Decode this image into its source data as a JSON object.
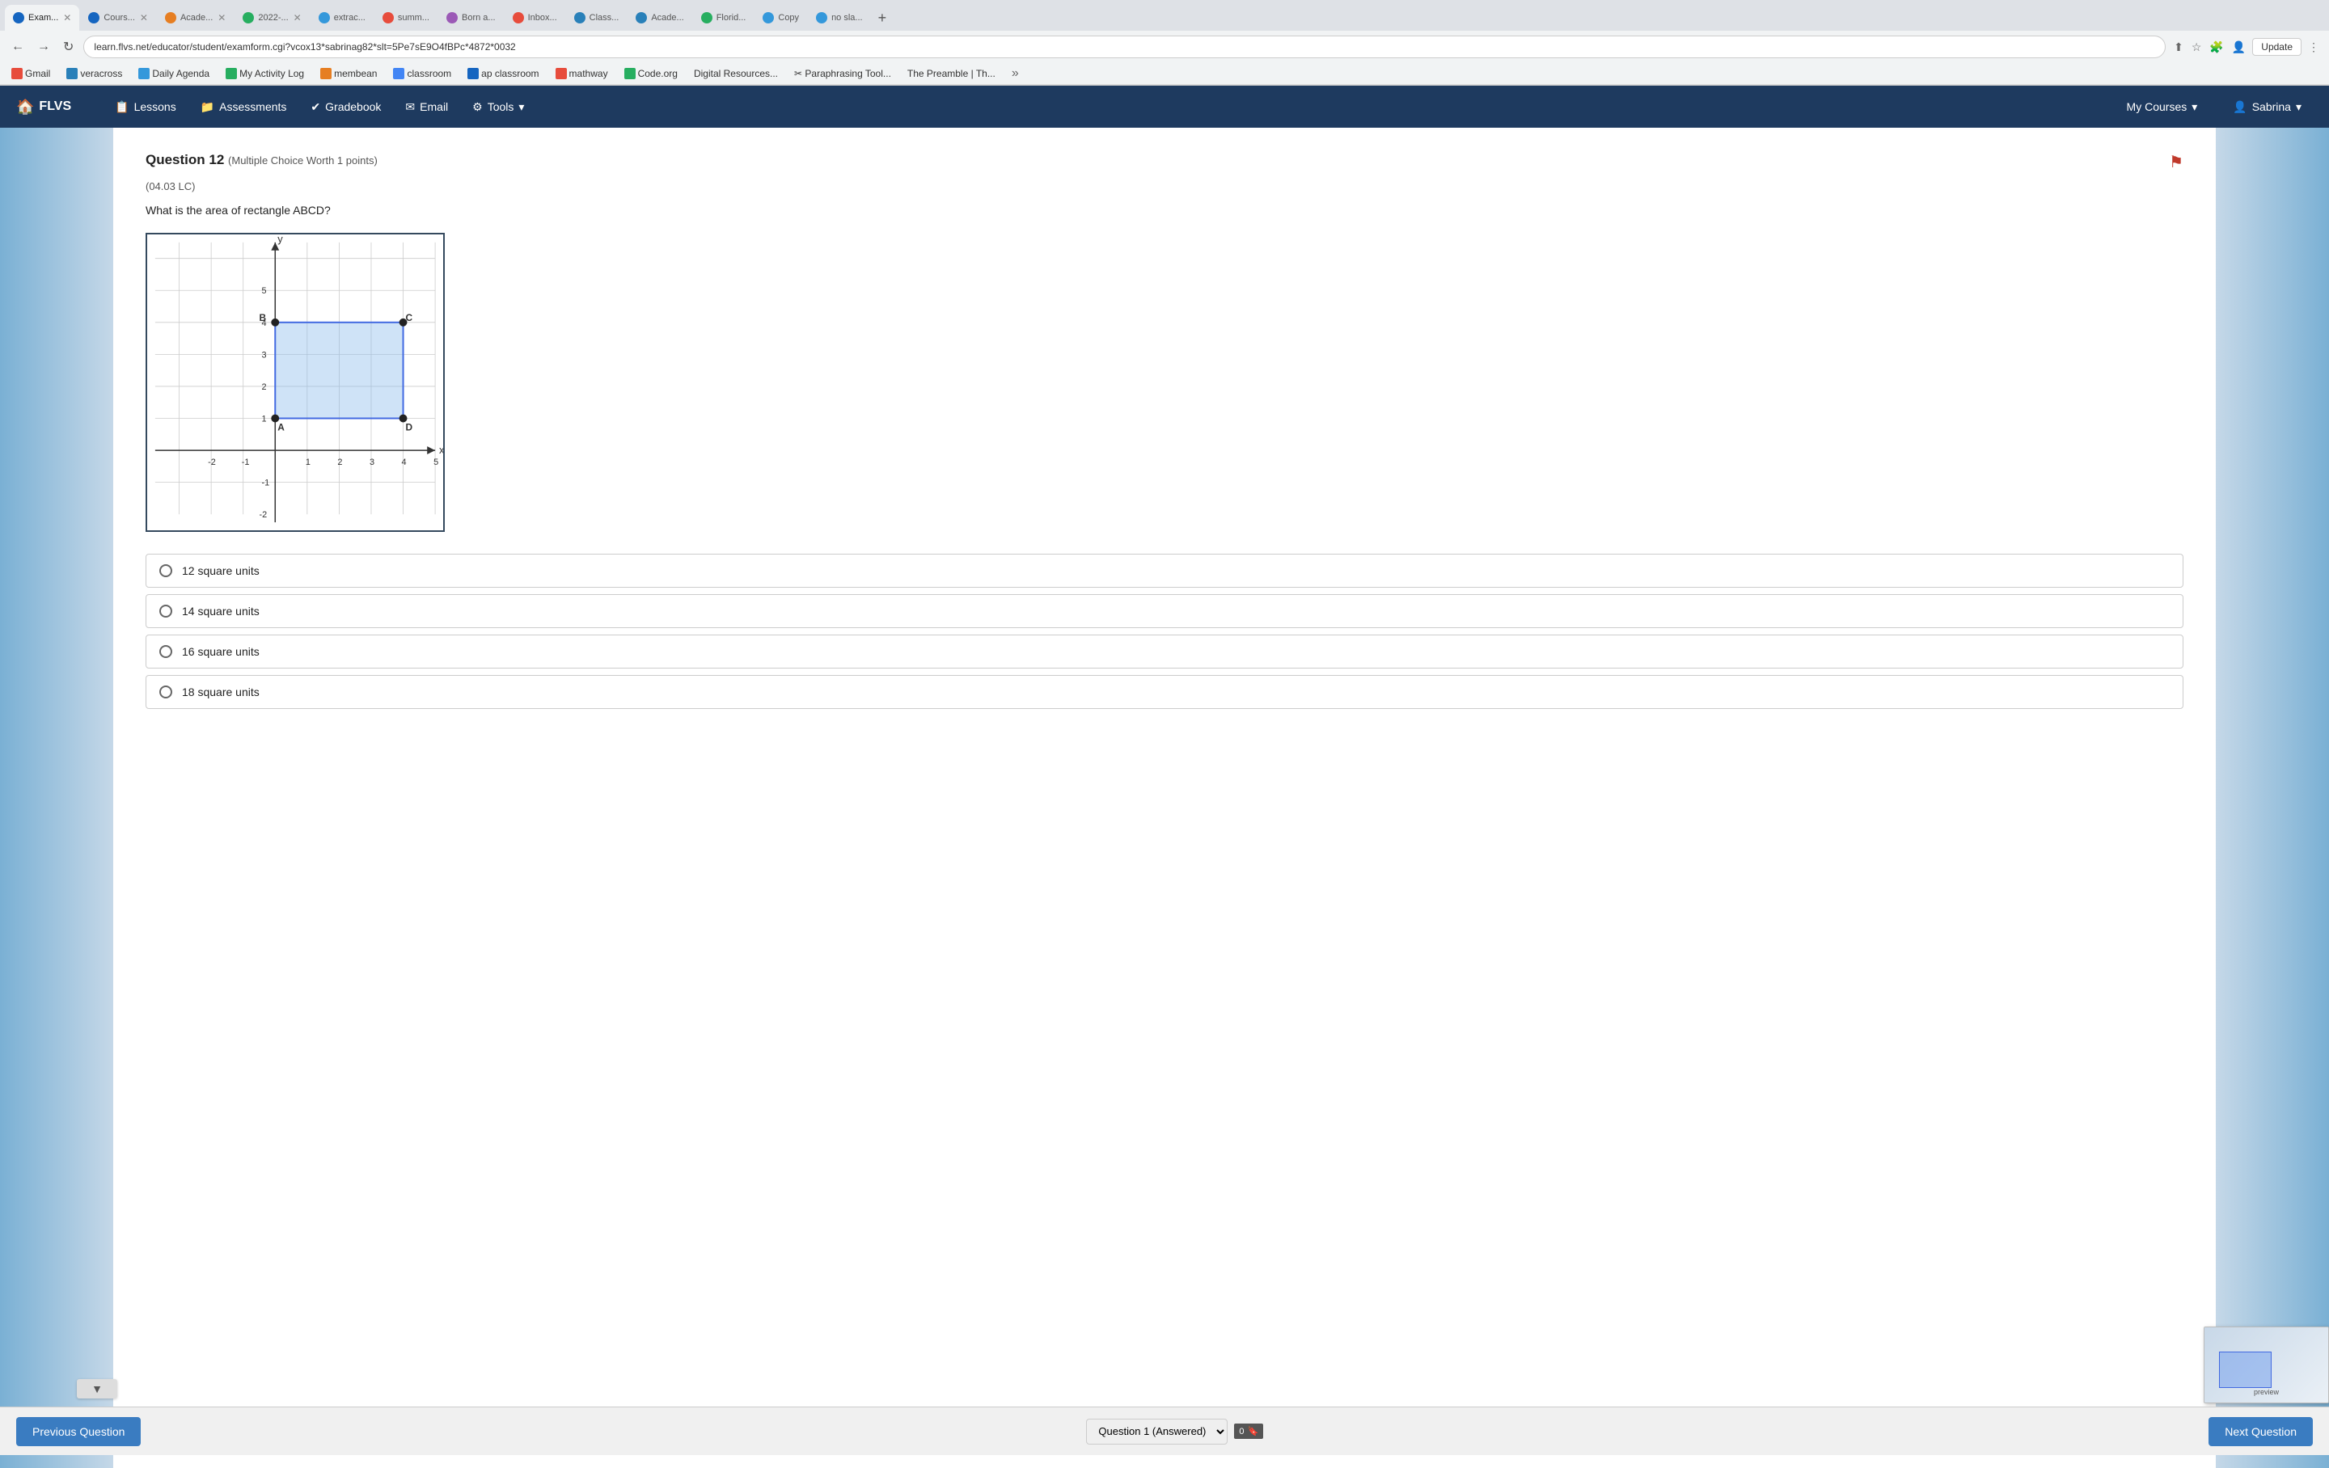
{
  "browser": {
    "address": "learn.flvs.net/educator/student/examform.cgi?vcox13*sabrinag82*slt=5Pe7sE9O4fBPc*4872*0032",
    "update_label": "Update",
    "tabs": [
      {
        "label": "Acade...",
        "active": false,
        "color": "#e67e22"
      },
      {
        "label": "2022-...",
        "active": false,
        "color": "#27ae60"
      },
      {
        "label": "extrac...",
        "active": false,
        "color": "#3498db"
      },
      {
        "label": "summ...",
        "active": false,
        "color": "#e74c3c"
      },
      {
        "label": "Born a...",
        "active": false,
        "color": "#9b59b6"
      },
      {
        "label": "Inbox ...",
        "active": false,
        "color": "#e74c3c"
      },
      {
        "label": "Class...",
        "active": false,
        "color": "#2980b9"
      },
      {
        "label": "Acade...",
        "active": false,
        "color": "#2980b9"
      },
      {
        "label": "Florid...",
        "active": false,
        "color": "#27ae60"
      },
      {
        "label": "Copy",
        "active": false,
        "color": "#3498db"
      },
      {
        "label": "no sla...",
        "active": false,
        "color": "#3498db"
      },
      {
        "label": "Exam...",
        "active": true,
        "color": "#1565C0"
      },
      {
        "label": "Cours...",
        "active": false,
        "color": "#1565C0"
      },
      {
        "label": "+",
        "active": false
      }
    ],
    "bookmarks": [
      {
        "label": "Gmail",
        "color": "#e74c3c"
      },
      {
        "label": "veracross",
        "color": "#2980b9"
      },
      {
        "label": "Daily Agenda",
        "color": "#3498db"
      },
      {
        "label": "My Activity Log",
        "color": "#27ae60"
      },
      {
        "label": "membean",
        "color": "#e67e22"
      },
      {
        "label": "classroom",
        "color": "#4285f4"
      },
      {
        "label": "ap classroom",
        "color": "#1565C0"
      },
      {
        "label": "mathway",
        "color": "#e74c3c"
      },
      {
        "label": "Code.org",
        "color": "#27ae60"
      },
      {
        "label": "Digital Resources...",
        "color": "#555"
      },
      {
        "label": "Paraphrasing Tool...",
        "color": "#555"
      },
      {
        "label": "The Preamble | Th...",
        "color": "#555"
      }
    ]
  },
  "nav": {
    "logo": "FLVS",
    "links": [
      {
        "label": "Lessons",
        "icon": "📋"
      },
      {
        "label": "Assessments",
        "icon": "📁"
      },
      {
        "label": "Gradebook",
        "icon": "✔"
      },
      {
        "label": "Email",
        "icon": "✉"
      },
      {
        "label": "Tools",
        "icon": "⚙",
        "dropdown": true
      }
    ],
    "right_links": [
      {
        "label": "My Courses",
        "dropdown": true
      },
      {
        "label": "Sabrina",
        "icon": "👤",
        "dropdown": true
      }
    ]
  },
  "question": {
    "number": "Question 12",
    "type": "(Multiple Choice Worth 1 points)",
    "code": "(04.03 LC)",
    "text": "What is the area of rectangle ABCD?",
    "answers": [
      {
        "id": "a",
        "text": "12 square units"
      },
      {
        "id": "b",
        "text": "14 square units"
      },
      {
        "id": "c",
        "text": "16 square units"
      },
      {
        "id": "d",
        "text": "18 square units"
      }
    ]
  },
  "bottom_bar": {
    "prev_label": "Previous Question",
    "next_label": "Next Question",
    "question_select_value": "Question 1 (Answered)",
    "answered_label": "0"
  },
  "graph": {
    "title": "Coordinate graph with rectangle ABCD",
    "points": {
      "A": [
        0,
        1
      ],
      "B": [
        0,
        4
      ],
      "C": [
        4,
        4
      ],
      "D": [
        4,
        1
      ]
    }
  }
}
